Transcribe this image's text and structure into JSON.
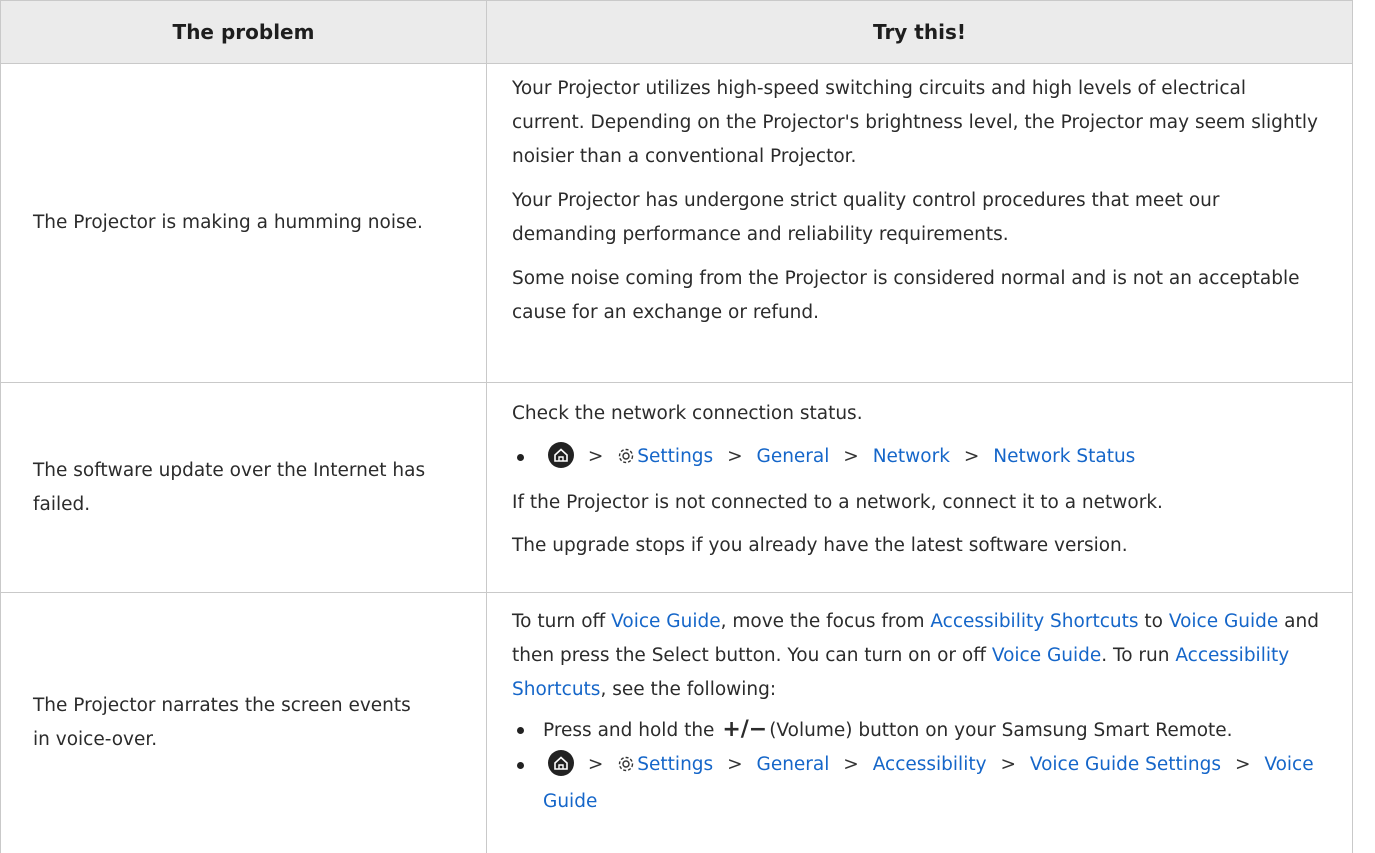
{
  "header": {
    "problem": "The problem",
    "solution": "Try this!"
  },
  "rows": [
    {
      "problem": "The Projector is making a humming noise.",
      "paras": [
        "Your Projector utilizes high-speed switching circuits and high levels of electrical current. Depending on the Projector's brightness level, the Projector may seem slightly noisier than a conventional Projector.",
        "Your Projector has undergone strict quality control procedures that meet our demanding performance and reliability requirements.",
        "Some noise coming from the Projector is considered normal and is not an acceptable cause for an exchange or refund."
      ]
    },
    {
      "problem": "The software update over the Internet has failed.",
      "intro": "Check the network connection status.",
      "path": [
        "Settings",
        "General",
        "Network",
        "Network Status"
      ],
      "para2": "If the Projector is not connected to a network, connect it to a network.",
      "para3": "The upgrade stops if you already have the latest software version."
    },
    {
      "problem": "The Projector narrates the screen events in voice-over.",
      "t1": "To turn off ",
      "l1": "Voice Guide",
      "t2": ", move the focus from ",
      "l2": "Accessibility Shortcuts",
      "t3": " to ",
      "l3": "Voice Guide",
      "t4": " and then press the Select button. You can turn on or off ",
      "l4": "Voice Guide",
      "t5": ". To run ",
      "l5": "Accessibility Shortcuts",
      "t6": ", see the following:",
      "bullet1_a": "Press and hold the ",
      "bullet1_b": "(Volume) button on your Samsung Smart Remote.",
      "path": [
        "Settings",
        "General",
        "Accessibility",
        "Voice Guide Settings",
        "Voice Guide"
      ]
    }
  ],
  "icons": {
    "home": "home-icon",
    "settings": "gear-icon",
    "chevron": "chevron-right-icon"
  },
  "colors": {
    "link": "#1566c9",
    "header_bg": "#ebebeb",
    "border": "#c9c9c9"
  }
}
